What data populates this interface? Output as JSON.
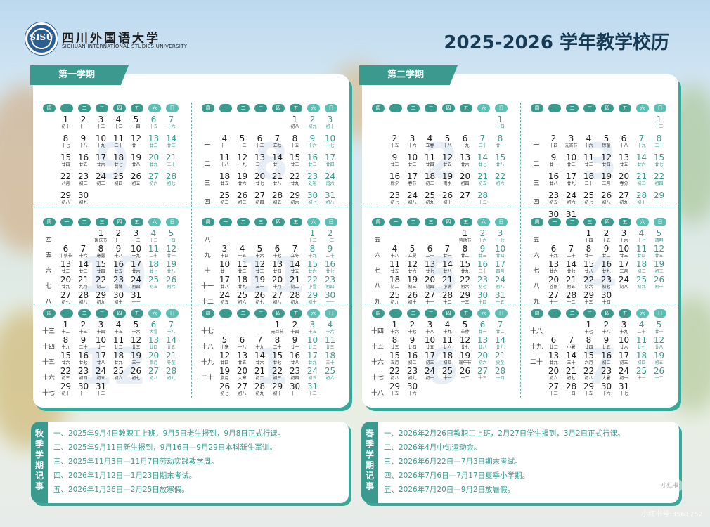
{
  "header": {
    "university_cn": "四川外国语大学",
    "university_en": "SICHUAN INTERNATIONAL STUDIES UNIVERSITY",
    "logo_text": "SISU",
    "title": "2025-2026 学年教学校历"
  },
  "weekday_labels": [
    "周",
    "一",
    "二",
    "三",
    "四",
    "五",
    "六",
    "日"
  ],
  "semesters": [
    {
      "name": "第一学期",
      "months": [
        {
          "num": "9",
          "start": 0,
          "days": 30,
          "weeks": [
            "",
            "",
            "",
            "",
            ""
          ],
          "lunar": [
            "初十",
            "十一",
            "十二",
            "十三",
            "十四",
            "十五",
            "十六",
            "十七",
            "十八",
            "十九",
            "二十",
            "廿一",
            "廿二",
            "廿三",
            "廿四",
            "廿五",
            "廿六",
            "廿七",
            "廿八",
            "廿九",
            "三十",
            "八月",
            "初二",
            "初三",
            "初四",
            "初五",
            "初六",
            "初七",
            "初八",
            "初九"
          ]
        },
        {
          "num": "10",
          "start": 2,
          "days": 31,
          "weeks": [
            "四",
            "五",
            "六",
            "七",
            "八"
          ],
          "lunar": [
            "国庆节",
            "十一",
            "十二",
            "十三",
            "十四",
            "中秋节",
            "十六",
            "寒露",
            "十八",
            "十九",
            "二十",
            "廿一",
            "廿二",
            "廿三",
            "廿四",
            "廿五",
            "廿六",
            "廿七",
            "廿八",
            "廿九",
            "九月",
            "初二",
            "霜降",
            "初四",
            "初五",
            "初六",
            "初七",
            "初八",
            "初九",
            "初十",
            "十一"
          ]
        },
        {
          "num": "12",
          "start": 0,
          "days": 31,
          "weeks": [
            "十三",
            "十四",
            "十五",
            "十六",
            "十七"
          ],
          "lunar": [
            "十二",
            "十三",
            "十四",
            "十五",
            "十六",
            "大雪",
            "十八",
            "十九",
            "二十",
            "廿一",
            "廿二",
            "廿三",
            "廿四",
            "廿五",
            "廿六",
            "廿七",
            "廿八",
            "廿九",
            "三十",
            "腊月",
            "冬至",
            "初三",
            "初四",
            "初五",
            "初六",
            "初七",
            "初八",
            "初九",
            "初十",
            "十一",
            "十二"
          ]
        },
        {
          "num": "8",
          "start": 4,
          "days": 31,
          "weeks": [
            "",
            "一",
            "二",
            "三",
            "四"
          ],
          "lunar": [
            "初八",
            "初九",
            "初十",
            "十一",
            "十二",
            "十三",
            "立秋",
            "十五",
            "十六",
            "十七",
            "十八",
            "十九",
            "二十",
            "廿一",
            "廿二",
            "廿三",
            "廿四",
            "廿五",
            "廿六",
            "廿七",
            "廿八",
            "廿九",
            "处暑",
            "闰六",
            "初二",
            "初三",
            "初四",
            "初五",
            "初六",
            "初七",
            "初八"
          ]
        },
        {
          "num": "11",
          "start": 5,
          "days": 30,
          "weeks": [
            "八",
            "九",
            "十",
            "十一",
            "十二"
          ],
          "lunar": [
            "十二",
            "十三",
            "十四",
            "十五",
            "十六",
            "十七",
            "立冬",
            "十九",
            "二十",
            "廿一",
            "廿二",
            "廿三",
            "廿四",
            "廿五",
            "廿六",
            "廿七",
            "廿八",
            "廿九",
            "三十",
            "十月",
            "初二",
            "小雪",
            "初四",
            "初五",
            "初六",
            "初七",
            "初八",
            "初九",
            "初十",
            "十一"
          ]
        },
        {
          "num": "1",
          "start": 3,
          "days": 31,
          "weeks": [
            "十七",
            "十八",
            "十九",
            "二十",
            ""
          ],
          "lunar": [
            "元旦节",
            "十四",
            "十五",
            "十六",
            "小寒",
            "十八",
            "十九",
            "二十",
            "廿一",
            "廿二",
            "廿三",
            "廿四",
            "廿五",
            "廿六",
            "廿七",
            "廿八",
            "廿九",
            "三十",
            "腊月",
            "大寒",
            "初二",
            "初三",
            "初四",
            "初五",
            "初六",
            "初七",
            "初八",
            "初九",
            "初十",
            "十一",
            "十二"
          ]
        }
      ]
    },
    {
      "name": "第二学期",
      "months": [
        {
          "num": "2",
          "start": 6,
          "days": 28,
          "weeks": [
            "",
            "",
            "",
            "",
            ""
          ],
          "lunar": [
            "十四",
            "十五",
            "十六",
            "立春",
            "十八",
            "十九",
            "二十",
            "廿一",
            "廿二",
            "廿三",
            "廿四",
            "廿五",
            "廿六",
            "廿七",
            "廿八",
            "除夕",
            "春节",
            "初二",
            "雨水",
            "初四",
            "初五",
            "初六",
            "初七",
            "初八",
            "初九",
            "初十",
            "十一",
            "十二"
          ]
        },
        {
          "num": "5",
          "start": 4,
          "days": 31,
          "weeks": [
            "五",
            "六",
            "七",
            "八",
            "九"
          ],
          "lunar": [
            "劳动节",
            "十六",
            "十七",
            "十八",
            "立夏",
            "二十",
            "廿一",
            "廿二",
            "廿三",
            "廿四",
            "廿五",
            "廿六",
            "廿七",
            "廿八",
            "廿九",
            "三十",
            "四月",
            "初二",
            "初三",
            "初四",
            "小满",
            "初六",
            "初七",
            "初八",
            "初九",
            "初十",
            "十一",
            "十二",
            "十三",
            "十四",
            "十五"
          ]
        },
        {
          "num": "6",
          "start": 0,
          "days": 30,
          "weeks": [
            "十四",
            "十五",
            "十六",
            "十七",
            "十八"
          ],
          "lunar": [
            "十六",
            "十七",
            "十八",
            "十九",
            "芒种",
            "廿一",
            "廿二",
            "廿三",
            "廿四",
            "廿五",
            "廿六",
            "廿七",
            "廿八",
            "廿九",
            "五月",
            "初二",
            "初三",
            "初四",
            "端午节",
            "初六",
            "夏至",
            "初八",
            "初九",
            "初十",
            "十一",
            "十二",
            "十三",
            "十四",
            "十五",
            "十六"
          ]
        },
        {
          "num": "3",
          "start": 6,
          "days": 31,
          "weeks": [
            "",
            "一",
            "二",
            "三",
            "四",
            "五"
          ],
          "lunar": [
            "十三",
            "十四",
            "元宵节",
            "十六",
            "惊蛰",
            "十八",
            "十九",
            "二十",
            "廿一",
            "廿二",
            "廿三",
            "廿四",
            "廿五",
            "廿六",
            "廿七",
            "廿八",
            "廿九",
            "三十",
            "二月",
            "春分",
            "初三",
            "初四",
            "初五",
            "初六",
            "初七",
            "初八",
            "初九",
            "初十",
            "十一",
            "十二",
            "十三"
          ]
        },
        {
          "num": "4",
          "start": 2,
          "days": 30,
          "weeks": [
            "五",
            "六",
            "七",
            "八",
            "九"
          ],
          "lunar": [
            "十四",
            "十五",
            "十六",
            "十七",
            "清明",
            "十九",
            "二十",
            "廿一",
            "廿二",
            "廿三",
            "廿四",
            "廿五",
            "廿六",
            "廿七",
            "廿八",
            "廿九",
            "三月",
            "初二",
            "初三",
            "谷雨",
            "初五",
            "初六",
            "初七",
            "初八",
            "初九",
            "初十",
            "十一",
            "十二",
            "十三",
            "十四"
          ]
        },
        {
          "num": "7",
          "start": 2,
          "days": 31,
          "weeks": [
            "十八",
            "十九",
            "二十",
            "",
            ""
          ],
          "lunar": [
            "十七",
            "十八",
            "十九",
            "二十",
            "廿一",
            "廿二",
            "小暑",
            "廿四",
            "廿五",
            "廿六",
            "廿七",
            "廿八",
            "廿九",
            "三十",
            "六月",
            "初二",
            "初三",
            "初四",
            "初五",
            "初六",
            "初七",
            "初八",
            "大暑",
            "初十",
            "十一",
            "十二",
            "十三",
            "十四",
            "十五",
            "十六",
            "十七"
          ]
        }
      ]
    }
  ],
  "notes": [
    {
      "side_label": "秋季学期记事",
      "items": [
        "一、2025年9月4日教职工上班，9月5日老生报到，9月8日正式行课。",
        "二、2025年9月11日新生报到，9月16日—9月29日本科新生军训。",
        "三、2025年11月3日—11月7日劳动实践教学周。",
        "四、2026年1月12日—1月23日期末考试。",
        "五、2026年1月26日—2月25日放寒假。"
      ]
    },
    {
      "side_label": "春季学期记事",
      "items": [
        "一、2026年2月26日教职工上班，2月27日学生报到，3月2日正式行课。",
        "二、2026年4月中旬运动会。",
        "三、2026年6月22日—7月3日期末考试。",
        "四、2026年7月6日—7月17日夏季小学期。",
        "五、2026年7月20日—9月2日放暑假。"
      ]
    }
  ],
  "watermark": {
    "badge": "小红书",
    "text": "小红书号:3561752"
  },
  "colors": {
    "teal": "#3b9a8e",
    "light_teal": "#5bbfb4",
    "weekend": "#3c9b8f",
    "title": "#173b55"
  }
}
